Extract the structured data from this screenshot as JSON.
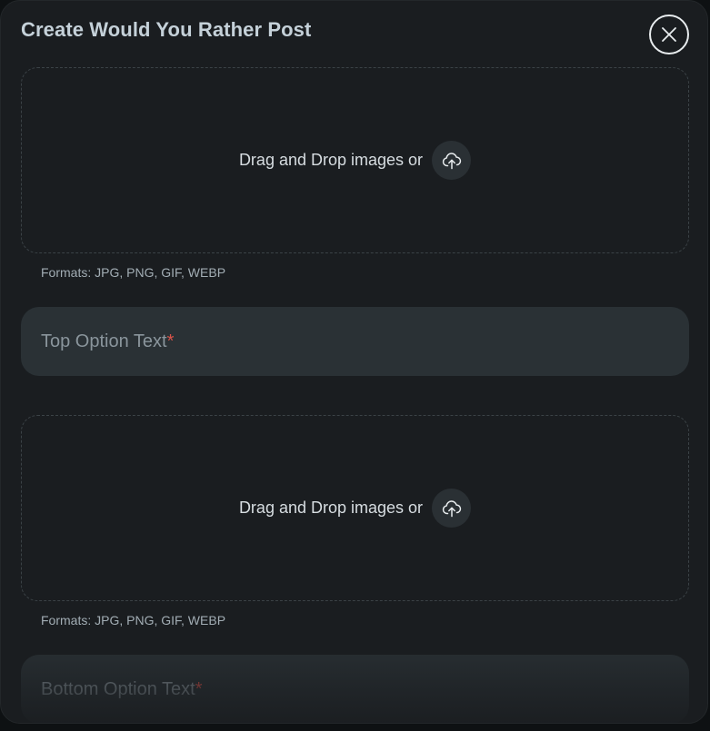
{
  "modal": {
    "title": "Create Would You Rather Post",
    "close_icon": "close-icon"
  },
  "top_upload": {
    "text": "Drag and Drop images or",
    "icon": "cloud-upload-icon",
    "formats": "Formats: JPG, PNG, GIF, WEBP"
  },
  "top_option": {
    "placeholder": "Top Option Text",
    "required_marker": "*"
  },
  "bottom_upload": {
    "text": "Drag and Drop images or",
    "icon": "cloud-upload-icon",
    "formats": "Formats: JPG, PNG, GIF, WEBP"
  },
  "bottom_option": {
    "placeholder": "Bottom Option Text",
    "required_marker": "*"
  },
  "colors": {
    "modal_bg": "#1a1d20",
    "field_bg": "#2a3135",
    "required": "#d9534a",
    "title": "#c5d1d9"
  }
}
